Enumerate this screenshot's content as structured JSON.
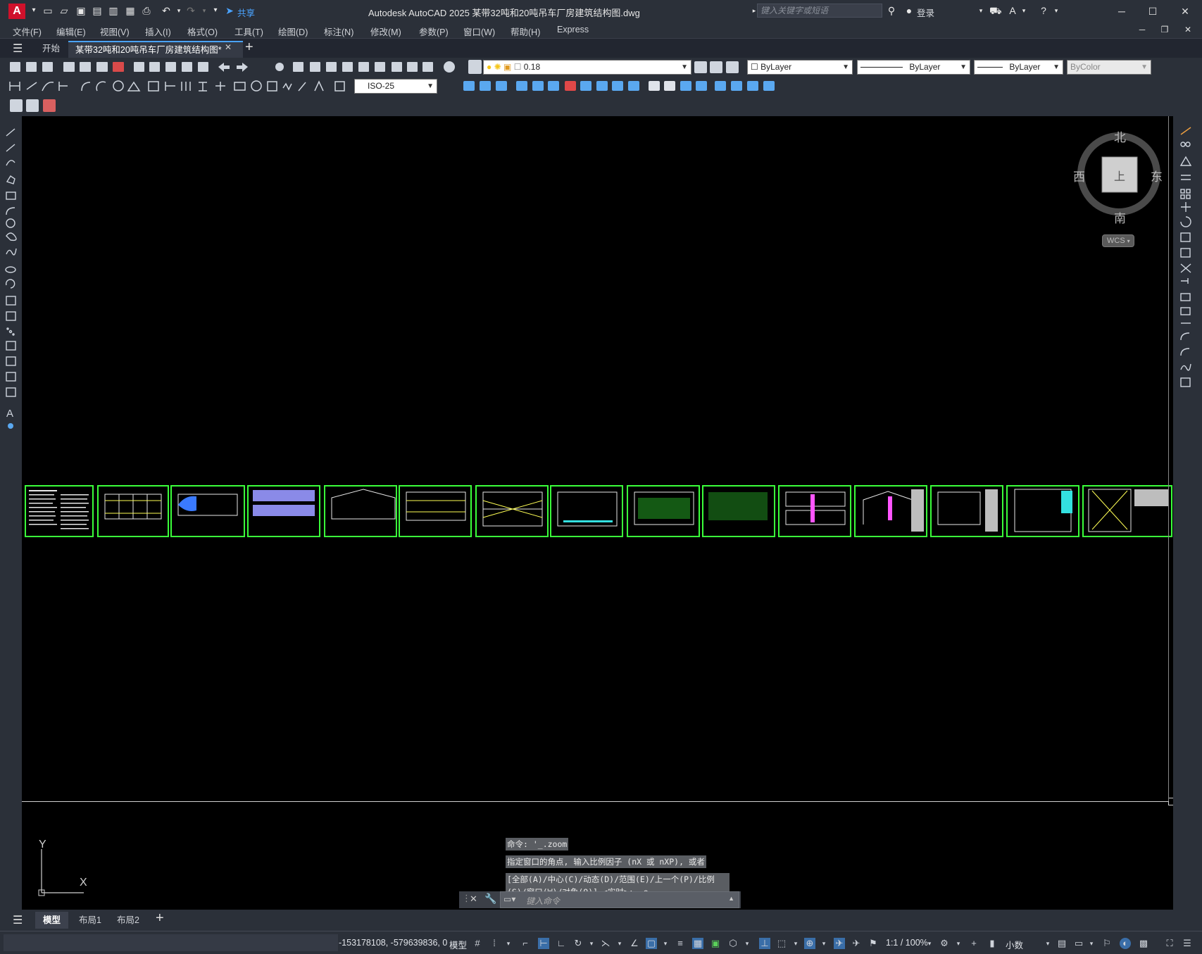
{
  "app": {
    "logo": "A",
    "title": "Autodesk AutoCAD 2025    某带32吨和20吨吊车厂房建筑结构图.dwg",
    "share_label": "共享",
    "search_placeholder": "键入关键字或短语",
    "login_label": "登录"
  },
  "menu": [
    "文件(F)",
    "编辑(E)",
    "视图(V)",
    "插入(I)",
    "格式(O)",
    "工具(T)",
    "绘图(D)",
    "标注(N)",
    "修改(M)",
    "参数(P)",
    "窗口(W)",
    "帮助(H)",
    "Express"
  ],
  "tabs": {
    "start": "开始",
    "document": "某带32吨和20吨吊车厂房建筑结构图*"
  },
  "toolbar": {
    "layer_value": "0.18",
    "color": "ByLayer",
    "linetype": "ByLayer",
    "lineweight": "ByLayer",
    "plotstyle": "ByColor",
    "dimstyle": "ISO-25"
  },
  "viewcube": {
    "north": "北",
    "south": "南",
    "east": "东",
    "west": "西",
    "face": "上",
    "wcs": "WCS"
  },
  "ucs": {
    "x": "X",
    "y": "Y"
  },
  "command": {
    "history": [
      "命令: '_.zoom",
      "指定窗口的角点, 输入比例因子 (nX 或 nXP), 或者",
      "[全部(A)/中心(C)/动态(D)/范围(E)/上一个(P)/比例",
      "(S)/窗口(W)/对象(O)] <实时>: _e"
    ],
    "input_placeholder": "键入命令"
  },
  "layout_tabs": [
    "模型",
    "布局1",
    "布局2"
  ],
  "status": {
    "coordinates": "-153178108, -579639836, 0",
    "space": "模型",
    "scale": "1:1 / 100%",
    "units": "小数"
  },
  "colors": {
    "accent_red": "#d0112b",
    "sheet_green": "#3aff3a",
    "canvas": "#000000"
  }
}
